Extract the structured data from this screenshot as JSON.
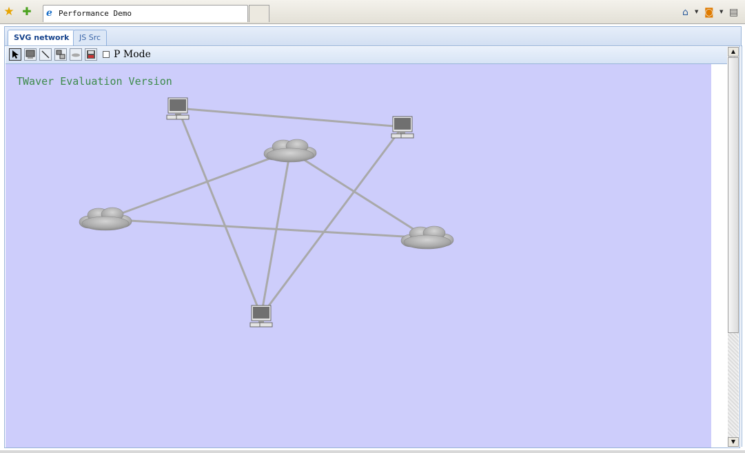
{
  "browser": {
    "tab_title": "Performance Demo",
    "icons": [
      "favorites-star-icon",
      "add-favorites-icon",
      "ie-icon",
      "home-icon",
      "rss-feed-icon",
      "print-icon"
    ]
  },
  "app": {
    "tabs": [
      {
        "label": "SVG network",
        "active": true
      },
      {
        "label": "JS Src",
        "active": false
      }
    ],
    "toolbar": {
      "buttons": [
        "select-tool",
        "add-computer-tool",
        "add-link-tool",
        "group-tool",
        "add-cloud-tool",
        "save-tool"
      ],
      "pmode_label": "P Mode",
      "pmode_checked": false
    },
    "watermark": "TWaver Evaluation Version",
    "colors": {
      "canvas_bg": "#cdcdfb",
      "link": "#a9a9a9",
      "watermark": "#3c8a4a"
    }
  },
  "network": {
    "nodes": [
      {
        "id": "pc-1",
        "type": "computer"
      },
      {
        "id": "pc-2",
        "type": "computer"
      },
      {
        "id": "pc-3",
        "type": "computer"
      },
      {
        "id": "cloud-1",
        "type": "cloud"
      },
      {
        "id": "cloud-2",
        "type": "cloud"
      },
      {
        "id": "cloud-3",
        "type": "cloud"
      }
    ],
    "links": [
      [
        "pc-1",
        "pc-2"
      ],
      [
        "pc-1",
        "pc-3"
      ],
      [
        "cloud-1",
        "cloud-2"
      ],
      [
        "cloud-1",
        "cloud-3"
      ],
      [
        "cloud-1",
        "pc-3"
      ],
      [
        "cloud-2",
        "cloud-3"
      ],
      [
        "pc-2",
        "pc-3"
      ]
    ]
  }
}
